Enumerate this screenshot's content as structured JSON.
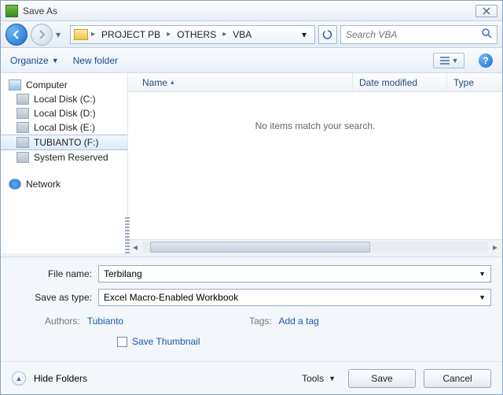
{
  "title": "Save As",
  "breadcrumb": {
    "seg1": "PROJECT PB",
    "seg2": "OTHERS",
    "seg3": "VBA"
  },
  "search": {
    "placeholder": "Search VBA"
  },
  "toolbar": {
    "organize": "Organize",
    "newfolder": "New folder"
  },
  "tree": {
    "computer": "Computer",
    "drives": [
      "Local Disk (C:)",
      "Local Disk (D:)",
      "Local Disk (E:)",
      "TUBIANTO (F:)",
      "System Reserved"
    ],
    "network": "Network"
  },
  "columns": {
    "name": "Name",
    "date": "Date modified",
    "type": "Type"
  },
  "empty_msg": "No items match your search.",
  "form": {
    "filename_label": "File name:",
    "filename_value": "Terbilang",
    "type_label": "Save as type:",
    "type_value": "Excel Macro-Enabled Workbook",
    "authors_label": "Authors:",
    "authors_value": "Tubianto",
    "tags_label": "Tags:",
    "tags_value": "Add a tag",
    "thumb": "Save Thumbnail"
  },
  "footer": {
    "hide": "Hide Folders",
    "tools": "Tools",
    "save": "Save",
    "cancel": "Cancel"
  }
}
